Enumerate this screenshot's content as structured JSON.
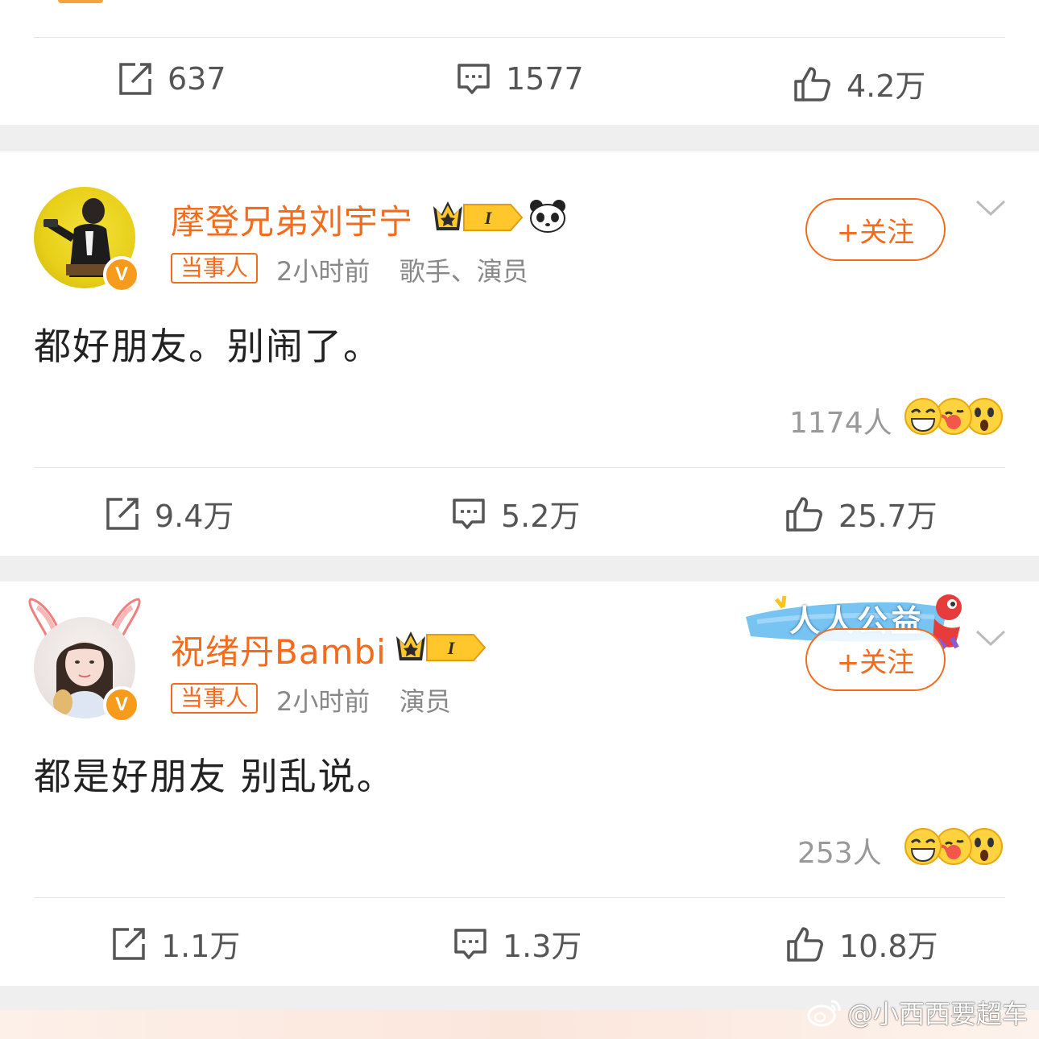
{
  "top_post": {
    "repost_count": "637",
    "comment_count": "1577",
    "like_count": "4.2万"
  },
  "posts": [
    {
      "username": "摩登兄弟刘宇宁",
      "member_level": "I",
      "tag": "当事人",
      "time": "2小时前",
      "profession": "歌手、演员",
      "follow_label": "+关注",
      "content": "都好朋友。别闹了。",
      "reaction_count": "1174人",
      "repost_count": "9.4万",
      "comment_count": "5.2万",
      "like_count": "25.7万",
      "verified_badge": "V"
    },
    {
      "username": "祝绪丹Bambi",
      "member_level": "I",
      "tag": "当事人",
      "time": "2小时前",
      "profession": "演员",
      "follow_label": "+关注",
      "content": "都是好朋友 别乱说。",
      "reaction_count": "253人",
      "repost_count": "1.1万",
      "comment_count": "1.3万",
      "like_count": "10.8万",
      "verified_badge": "V",
      "banner_text": "人人公益"
    }
  ],
  "watermark": "@小西西要超车",
  "colors": {
    "accent": "#f36b1c",
    "badge": "#f79b1d",
    "separator": "#efefef"
  },
  "icons": [
    "repost-icon",
    "comment-icon",
    "like-icon",
    "chevron-down-icon",
    "crown-icon",
    "panda-icon",
    "weibo-logo-icon"
  ]
}
